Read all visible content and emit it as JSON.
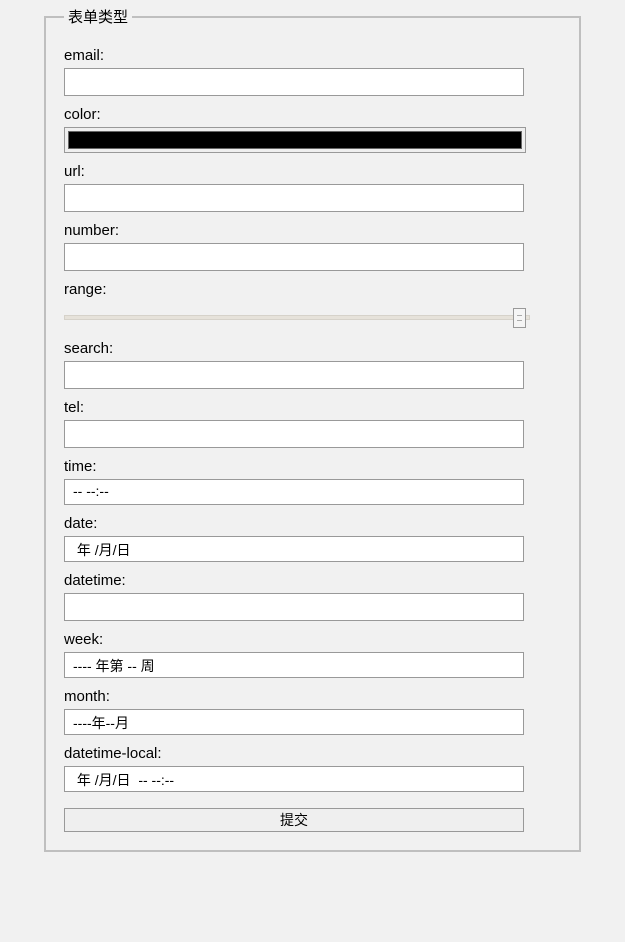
{
  "legend": "表单类型",
  "fields": {
    "email": {
      "label": "email:",
      "value": ""
    },
    "color": {
      "label": "color:",
      "value": "#000000"
    },
    "url": {
      "label": "url:",
      "value": ""
    },
    "number": {
      "label": "number:",
      "value": ""
    },
    "range": {
      "label": "range:",
      "value": 100,
      "min": 0,
      "max": 100
    },
    "search": {
      "label": "search:",
      "value": ""
    },
    "tel": {
      "label": "tel:",
      "value": ""
    },
    "time": {
      "label": "time:",
      "display": "-- --:--"
    },
    "date": {
      "label": "date:",
      "display": " 年 /月/日"
    },
    "datetime": {
      "label": "datetime:",
      "value": ""
    },
    "week": {
      "label": "week:",
      "display": "---- 年第 -- 周"
    },
    "month": {
      "label": "month:",
      "display": "----年--月"
    },
    "datetime_local": {
      "label": "datetime-local:",
      "display": " 年 /月/日  -- --:--"
    }
  },
  "submit_label": "提交"
}
